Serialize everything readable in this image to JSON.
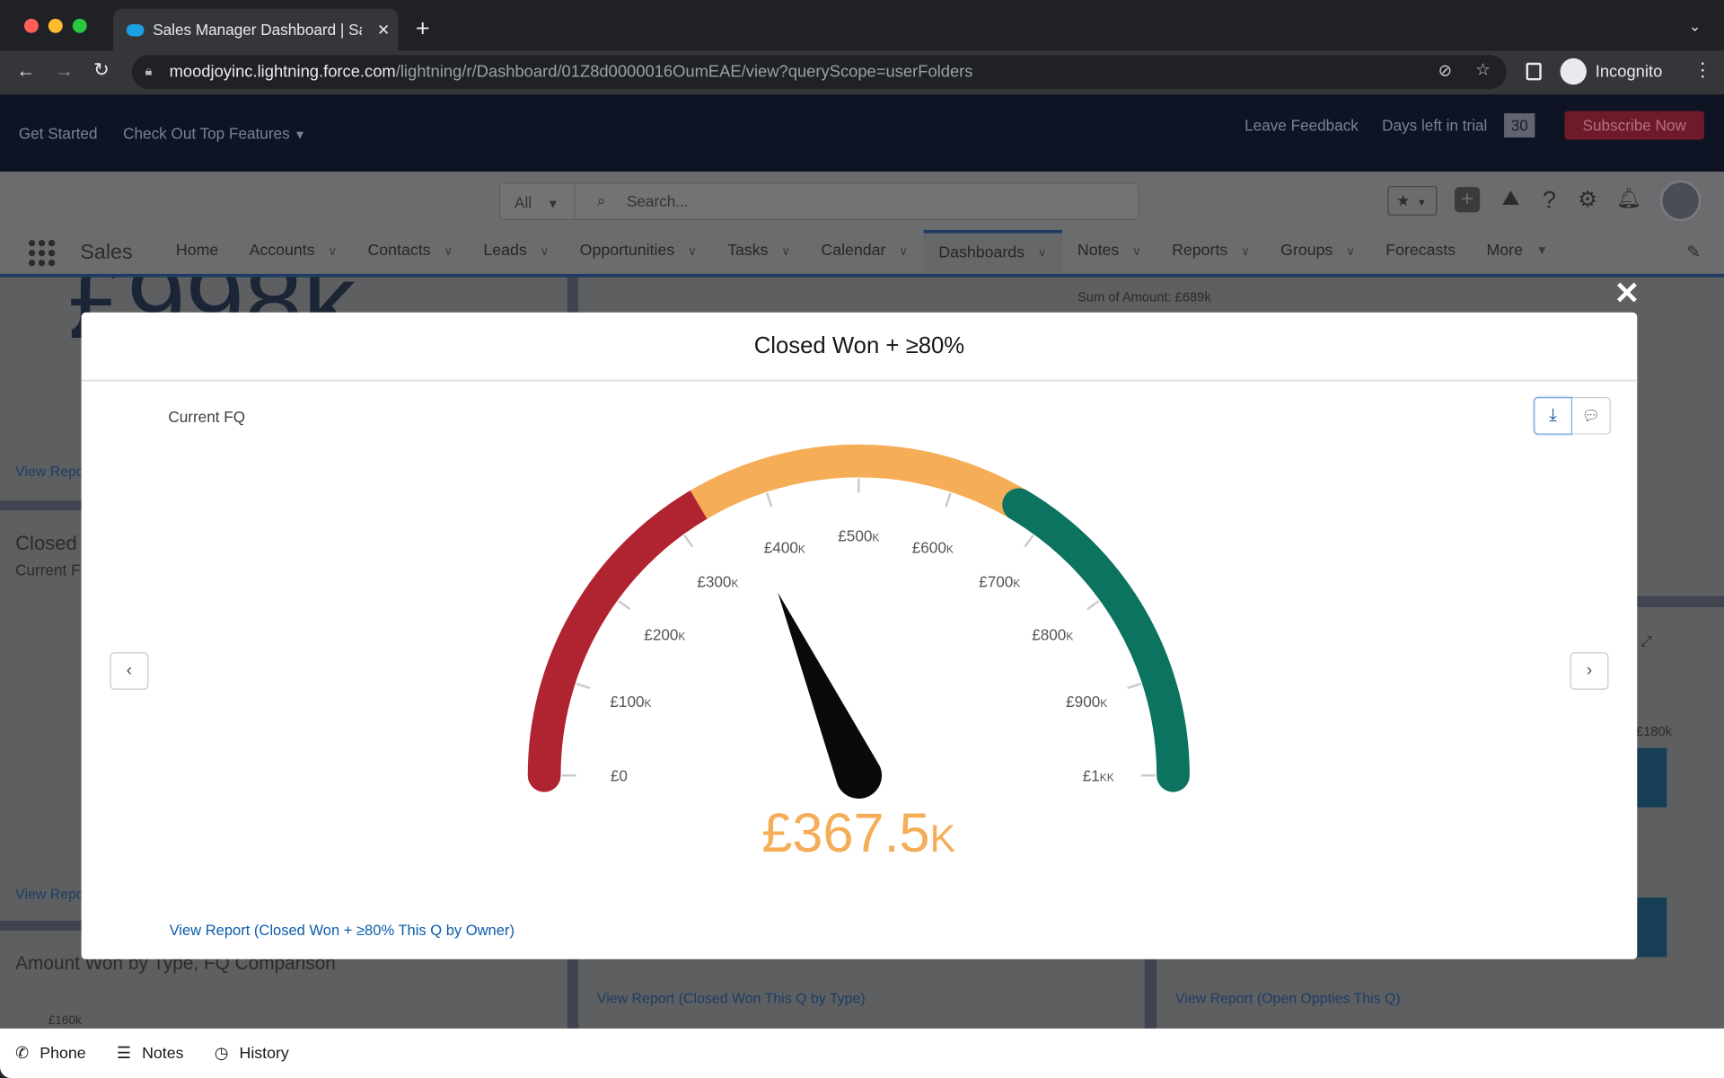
{
  "browser": {
    "tab_title": "Sales Manager Dashboard | Sa",
    "url_host": "moodjoyinc.lightning.force.com",
    "url_path": "/lightning/r/Dashboard/01Z8d0000016OumEAE/view?queryScope=userFolders",
    "profile_label": "Incognito"
  },
  "trial_bar": {
    "get_started": "Get Started",
    "top_features": "Check Out Top Features",
    "leave_feedback": "Leave Feedback",
    "days_left_label": "Days left in trial",
    "days_left": "30",
    "subscribe": "Subscribe Now"
  },
  "header": {
    "search_scope": "All",
    "search_placeholder": "Search...",
    "app_name": "Sales",
    "nav": [
      {
        "label": "Home",
        "menu": false
      },
      {
        "label": "Accounts",
        "menu": true
      },
      {
        "label": "Contacts",
        "menu": true
      },
      {
        "label": "Leads",
        "menu": true
      },
      {
        "label": "Opportunities",
        "menu": true
      },
      {
        "label": "Tasks",
        "menu": true
      },
      {
        "label": "Calendar",
        "menu": true
      },
      {
        "label": "Dashboards",
        "menu": true,
        "active": true
      },
      {
        "label": "Notes",
        "menu": true
      },
      {
        "label": "Reports",
        "menu": true
      },
      {
        "label": "Groups",
        "menu": true
      },
      {
        "label": "Forecasts",
        "menu": false
      },
      {
        "label": "More",
        "menu": true
      }
    ]
  },
  "background_dashboard": {
    "big_metric": "£998k",
    "view_report_1": "View Repo",
    "closed_title": "Closed",
    "closed_sub": "Current F",
    "view_report_2": "View Repo",
    "amount_won_title": "Amount Won by Type, FQ Comparison",
    "axis_tick_160": "£160k",
    "sum_of_amount": "Sum of Amount: £689k",
    "axis_tick_180": "£180k",
    "view_report_type": "View Report (Closed Won This Q by Type)",
    "view_report_open": "View Report (Open Oppties This Q)"
  },
  "modal": {
    "title": "Closed Won + ≥80%",
    "subtitle": "Current FQ",
    "view_report": "View Report (Closed Won + ≥80% This Q by Owner)"
  },
  "chart_data": {
    "type": "gauge",
    "title": "Closed Won + ≥80%",
    "subtitle": "Current FQ",
    "min": 0,
    "max": 1000000,
    "value": 367500,
    "value_label": "£367.5k",
    "tick_labels": [
      "£0",
      "£100k",
      "£200k",
      "£300k",
      "£400k",
      "£500k",
      "£600k",
      "£700k",
      "£800k",
      "£900k",
      "£1kk"
    ],
    "ticks": [
      0,
      100000,
      200000,
      300000,
      400000,
      500000,
      600000,
      700000,
      800000,
      900000,
      1000000
    ],
    "bands": [
      {
        "from": 0,
        "to": 330000,
        "color": "#b02331"
      },
      {
        "from": 330000,
        "to": 670000,
        "color": "#f5ad57"
      },
      {
        "from": 670000,
        "to": 1000000,
        "color": "#0b7360"
      }
    ],
    "value_color": "#f5ad57",
    "needle_color": "#0a0a0a"
  },
  "utility_bar": {
    "phone": "Phone",
    "notes": "Notes",
    "history": "History"
  }
}
